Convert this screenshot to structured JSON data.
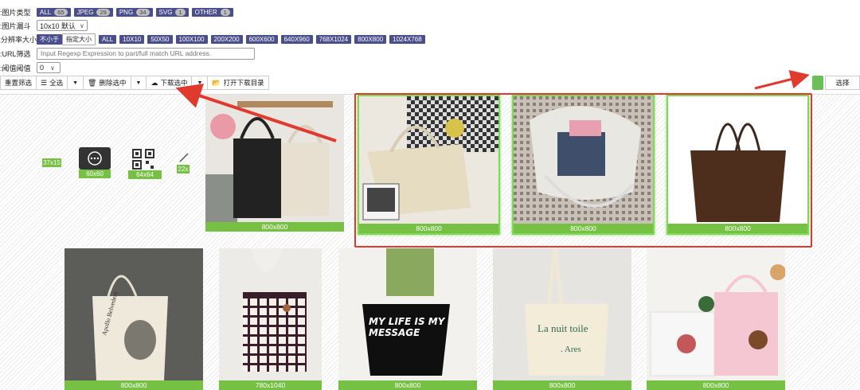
{
  "filters": {
    "type": {
      "label": "图片类型:",
      "chips": [
        {
          "name": "ALL",
          "count": "65"
        },
        {
          "name": "JPEG",
          "count": "29"
        },
        {
          "name": "PNG",
          "count": "34"
        },
        {
          "name": "SVG",
          "count": "1"
        },
        {
          "name": "OTHER",
          "count": "1"
        }
      ]
    },
    "funnel": {
      "label": "图片漏斗:",
      "value": "10x10 默认"
    },
    "resolution": {
      "label": "分辨率大小:",
      "chips": [
        "不小于",
        "指定大小",
        "ALL",
        "10X10",
        "50X50",
        "100X100",
        "200X200",
        "600X600",
        "640X960",
        "768X1024",
        "800X800",
        "1024X768"
      ]
    },
    "url": {
      "label": "URL筛选:",
      "placeholder": "Input Regexp Expression to part/full match URL address."
    },
    "threshold": {
      "label": "阈值阈值:",
      "value": "0"
    }
  },
  "toolbar": {
    "reset": "重置筛选",
    "select_all": "全选",
    "delete_selected": "删除选中",
    "download_selected": "下载选中",
    "open_folder": "打开下载目录",
    "select": "选择"
  },
  "colors": {
    "accent_green": "#76c044",
    "chip": "#4a4f8c",
    "annotation_red": "#e03a2f"
  },
  "small_items": [
    {
      "caption": "37x15"
    },
    {
      "caption": "60x60",
      "icon": "chat-bubble-icon"
    },
    {
      "caption": "64x64",
      "icon": "qr-code-icon"
    },
    {
      "caption": "22x"
    }
  ],
  "row1": [
    {
      "caption": "800x800",
      "selected": false,
      "desc": "bags-on-hooks"
    },
    {
      "caption": "800x800",
      "selected": true,
      "desc": "cream-tote-on-plaid"
    },
    {
      "caption": "800x800",
      "selected": true,
      "desc": "open-canvas-tote"
    },
    {
      "caption": "800x800",
      "selected": true,
      "desc": "brown-tote"
    }
  ],
  "row2": [
    {
      "caption": "800x800",
      "desc": "apollo-print-tote"
    },
    {
      "caption": "780x1040",
      "desc": "checkered-tote"
    },
    {
      "caption": "800x800",
      "desc": "my-life-is-my-message-tote"
    },
    {
      "caption": "800x800",
      "desc": "la-nuit-toile-tote"
    },
    {
      "caption": "800x800",
      "desc": "pink-bear-tote"
    }
  ],
  "prints": {
    "apollo": "Apollo Belvedere",
    "message": "MY LIFE IS MY MESSAGE",
    "nuit": "La nuit toile",
    "ares": ". Ares"
  }
}
